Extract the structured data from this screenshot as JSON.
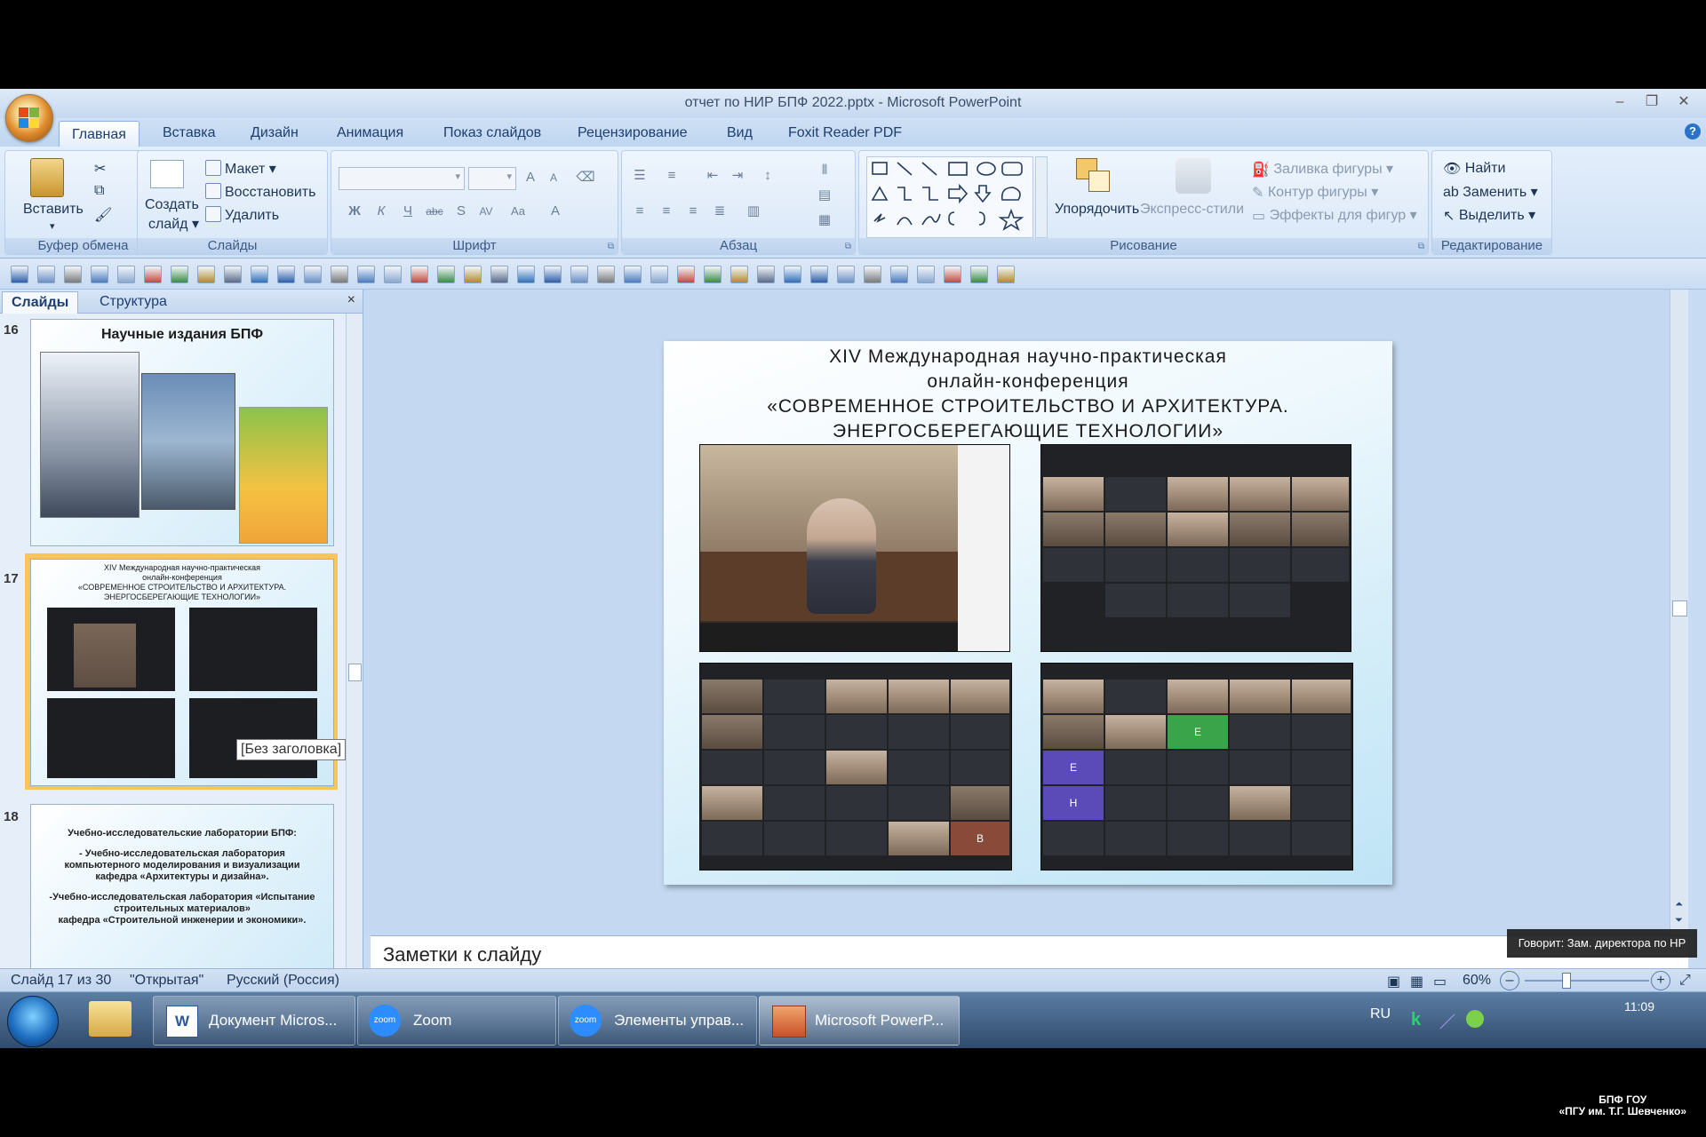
{
  "window": {
    "title": "отчет по НИР БПФ 2022.pptx - Microsoft PowerPoint"
  },
  "tabs": [
    "Главная",
    "Вставка",
    "Дизайн",
    "Анимация",
    "Показ слайдов",
    "Рецензирование",
    "Вид",
    "Foxit Reader PDF"
  ],
  "ribbon": {
    "clipboard": {
      "paste": "Вставить",
      "label": "Буфер обмена"
    },
    "slides": {
      "new_slide": "Создать",
      "new_slide2": "слайд",
      "layout": "Макет",
      "reset": "Восстановить",
      "delete": "Удалить",
      "label": "Слайды"
    },
    "font": {
      "label": "Шрифт"
    },
    "paragraph": {
      "label": "Абзац"
    },
    "drawing": {
      "arrange": "Упорядочить",
      "quick_styles": "Экспресс-стили",
      "fill": "Заливка фигуры",
      "outline": "Контур фигуры",
      "effects": "Эффекты для фигур",
      "label": "Рисование"
    },
    "editing": {
      "find": "Найти",
      "replace": "Заменить",
      "select": "Выделить",
      "label": "Редактирование"
    }
  },
  "panel": {
    "tab_slides": "Слайды",
    "tab_outline": "Структура",
    "close": "×",
    "slide16": {
      "num": "16",
      "title": "Научные издания БПФ"
    },
    "slide17": {
      "num": "17",
      "title_lines": [
        "XIV Международная научно-практическая",
        "онлайн-конференция",
        "«СОВРЕМЕННОЕ СТРОИТЕЛЬСТВО И АРХИТЕКТУРА.",
        "ЭНЕРГОСБЕРЕГАЮЩИЕ ТЕХНОЛОГИИ»"
      ]
    },
    "slide18": {
      "num": "18",
      "lines": [
        "Учебно-исследовательские лаборатории БПФ:",
        "- Учебно-исследовательская лаборатория",
        "компьютерного моделирования и визуализации",
        "кафедра «Архитектуры и дизайна».",
        "-Учебно-исследовательская лаборатория «Испытание",
        "строительных материалов»",
        "кафедра «Строительной инженерии и экономики»."
      ]
    },
    "tooltip": "[Без заголовка]"
  },
  "slide": {
    "title_lines": [
      "XIV Международная  научно-практическая",
      "онлайн-конференция",
      "«СОВРЕМЕННОЕ СТРОИТЕЛЬСТВО И АРХИТЕКТУРА.",
      "ЭНЕРГОСБЕРЕГАЮЩИЕ ТЕХНОЛОГИИ»"
    ]
  },
  "notes": {
    "placeholder": "Заметки к слайду"
  },
  "status": {
    "slide_counter": "Слайд 17 из 30",
    "theme": "\"Открытая\"",
    "language": "Русский (Россия)",
    "zoom": "60%"
  },
  "taskbar": {
    "items": [
      "Документ Micros...",
      "Zoom",
      "Элементы управ...",
      "Microsoft PowerP..."
    ],
    "lang": "RU",
    "clock": "11:09",
    "speaker": "Говорит: Зам. директора по НР"
  },
  "watermark": {
    "line1": "БПФ ГОУ",
    "line2": "«ПГУ им. Т.Г. Шевченко»"
  },
  "colors": {
    "accent": "#1d3e6e",
    "selected_thumb": "#f7c55a",
    "zoom_blue": "#2d8cff"
  }
}
